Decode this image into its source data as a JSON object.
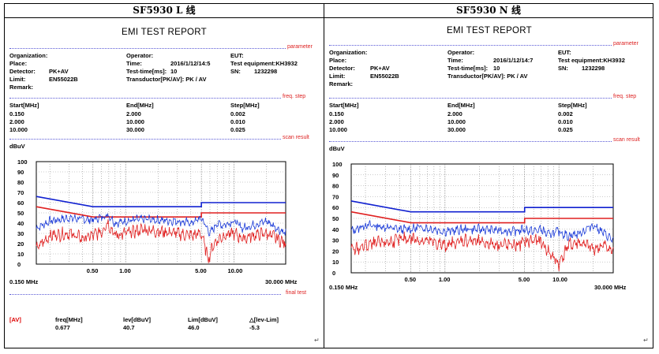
{
  "headers": {
    "left": "SF5930 L 线",
    "right": "SF5930 N 线"
  },
  "reports": [
    {
      "title": "EMI TEST REPORT",
      "sections": {
        "parameter": "parameter",
        "freq_step": "freq. step",
        "scan_result": "scan result",
        "final_test": "final test"
      },
      "fields": {
        "organization": "Organization:",
        "operator": "Operator:",
        "eut": "EUT:",
        "place": "Place:",
        "time_label": "Time:",
        "time_value": "2016/1/12/14:5",
        "test_equipment": "Test equipment:KH3932",
        "detector_label": "Detector:",
        "detector_value": "PK+AV",
        "test_time_label": "Test-time[ms]:",
        "test_time_value": "10",
        "sn_label": "SN:",
        "sn_value": "1232298",
        "limit_label": "Limit:",
        "limit_value": "EN55022B",
        "transductor": "Transductor[PK/AV]: PK  /  AV",
        "remark": "Remark:"
      },
      "freq_table": {
        "headers": [
          "Start[MHz]",
          "End[MHz]",
          "Step[MHz]"
        ],
        "rows": [
          [
            "0.150",
            "2.000",
            "0.002"
          ],
          [
            "2.000",
            "10.000",
            "0.010"
          ],
          [
            "10.000",
            "30.000",
            "0.025"
          ]
        ]
      },
      "unit": "dBuV",
      "x_left": "0.150 MHz",
      "x_right": "30.000 MHz",
      "final": {
        "tag": "[AV]",
        "headers": [
          "freq[MHz]",
          "lev[dBuV]",
          "Lim[dBuV]",
          "△[lev-Lim]"
        ],
        "values": [
          "0.677",
          "40.7",
          "46.0",
          "-5.3"
        ]
      },
      "chart_data": {
        "type": "line",
        "xscale": "log",
        "xlim": [
          0.15,
          30
        ],
        "ylim": [
          0,
          100
        ],
        "xticks": [
          0.5,
          1,
          5,
          10
        ],
        "xtick_labels": [
          "0.50",
          "1.00",
          "5.00",
          "10.00"
        ],
        "yticks": [
          0,
          10,
          20,
          30,
          40,
          50,
          60,
          70,
          80,
          90,
          100
        ],
        "grid": true,
        "series": [
          {
            "role": "qp-limit",
            "color": "#1020d0",
            "x": [
              0.15,
              0.5,
              5,
              5,
              30
            ],
            "y": [
              66,
              56,
              56,
              60,
              60
            ]
          },
          {
            "role": "av-limit",
            "color": "#e02020",
            "x": [
              0.15,
              0.5,
              5,
              5,
              30
            ],
            "y": [
              56,
              46,
              46,
              50,
              50
            ]
          },
          {
            "role": "peak",
            "color": "#1a3ad8",
            "x": [
              0.15,
              0.2,
              0.3,
              0.4,
              0.5,
              0.6,
              0.7,
              0.8,
              1,
              1.5,
              2,
              3,
              4,
              5,
              6,
              7,
              8,
              10,
              12,
              15,
              20,
              25,
              30
            ],
            "y": [
              35,
              42,
              45,
              44,
              43,
              46,
              48,
              40,
              42,
              44,
              43,
              42,
              40,
              45,
              30,
              40,
              38,
              42,
              35,
              38,
              42,
              35,
              30
            ]
          },
          {
            "role": "average",
            "color": "#e02020",
            "x": [
              0.15,
              0.2,
              0.3,
              0.4,
              0.5,
              0.6,
              0.677,
              0.8,
              1,
              1.5,
              2,
              3,
              4,
              5,
              5.8,
              6.5,
              8,
              10,
              12,
              15,
              20,
              25,
              30
            ],
            "y": [
              15,
              28,
              30,
              25,
              28,
              32,
              41,
              28,
              30,
              34,
              32,
              30,
              28,
              30,
              5,
              20,
              28,
              30,
              25,
              28,
              30,
              25,
              20
            ]
          }
        ]
      }
    },
    {
      "title": "EMI TEST REPORT",
      "sections": {
        "parameter": "parameter",
        "freq_step": "freq. step",
        "scan_result": "scan result"
      },
      "fields": {
        "organization": "Organization:",
        "operator": "Operator:",
        "eut": "EUT:",
        "place": "Place:",
        "time_label": "Time:",
        "time_value": "2016/1/12/14:7",
        "test_equipment": "Test equipment:KH3932",
        "detector_label": "Detector:",
        "detector_value": "PK+AV",
        "test_time_label": "Test-time[ms]:",
        "test_time_value": "10",
        "sn_label": "SN:",
        "sn_value": "1232298",
        "limit_label": "Limit:",
        "limit_value": "EN55022B",
        "transductor": "Transductor[PK/AV]: PK  /  AV",
        "remark": "Remark:"
      },
      "freq_table": {
        "headers": [
          "Start[MHz]",
          "End[MHz]",
          "Step[MHz]"
        ],
        "rows": [
          [
            "0.150",
            "2.000",
            "0.002"
          ],
          [
            "2.000",
            "10.000",
            "0.010"
          ],
          [
            "10.000",
            "30.000",
            "0.025"
          ]
        ]
      },
      "unit": "dBuV",
      "x_left": "0.150 MHz",
      "x_right": "30.000 MHz",
      "chart_data": {
        "type": "line",
        "xscale": "log",
        "xlim": [
          0.15,
          30
        ],
        "ylim": [
          0,
          100
        ],
        "xticks": [
          0.5,
          1,
          5,
          10
        ],
        "xtick_labels": [
          "0.50",
          "1.00",
          "5.00",
          "10.00"
        ],
        "yticks": [
          0,
          10,
          20,
          30,
          40,
          50,
          60,
          70,
          80,
          90,
          100
        ],
        "grid": true,
        "series": [
          {
            "role": "qp-limit",
            "color": "#1020d0",
            "x": [
              0.15,
              0.5,
              5,
              5,
              30
            ],
            "y": [
              66,
              56,
              56,
              60,
              60
            ]
          },
          {
            "role": "av-limit",
            "color": "#e02020",
            "x": [
              0.15,
              0.5,
              5,
              5,
              30
            ],
            "y": [
              56,
              46,
              46,
              50,
              50
            ]
          },
          {
            "role": "peak",
            "color": "#1a3ad8",
            "x": [
              0.15,
              0.2,
              0.3,
              0.4,
              0.5,
              0.6,
              0.8,
              1,
              1.5,
              2,
              3,
              4,
              5,
              6,
              7,
              8,
              10,
              12,
              15,
              20,
              25,
              30
            ],
            "y": [
              38,
              44,
              42,
              40,
              40,
              42,
              40,
              38,
              40,
              40,
              39,
              38,
              40,
              38,
              40,
              35,
              38,
              34,
              36,
              44,
              36,
              30
            ]
          },
          {
            "role": "average",
            "color": "#e02020",
            "x": [
              0.15,
              0.2,
              0.3,
              0.4,
              0.5,
              0.6,
              0.8,
              1,
              1.5,
              2,
              3,
              4,
              5,
              6,
              7,
              8,
              10,
              12,
              15,
              20,
              25,
              30
            ],
            "y": [
              20,
              25,
              28,
              30,
              32,
              30,
              28,
              25,
              30,
              28,
              26,
              25,
              28,
              30,
              28,
              20,
              8,
              25,
              28,
              22,
              25,
              20
            ]
          }
        ]
      }
    }
  ]
}
